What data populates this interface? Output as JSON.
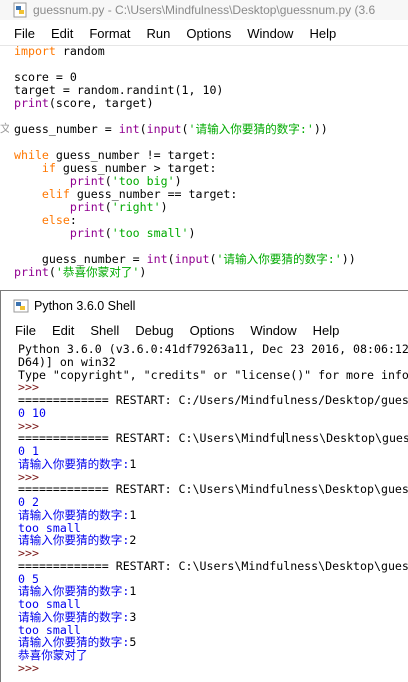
{
  "editor": {
    "title": "guessnum.py - C:\\Users\\Mindfulness\\Desktop\\guessnum.py (3.6",
    "menu": [
      "File",
      "Edit",
      "Format",
      "Run",
      "Options",
      "Window",
      "Help"
    ],
    "code": [
      [
        {
          "c": "kw",
          "t": "import"
        },
        {
          "c": "",
          "t": " random"
        }
      ],
      [],
      [
        {
          "c": "",
          "t": "score = 0"
        }
      ],
      [
        {
          "c": "",
          "t": "target = random.randint(1, 10)"
        }
      ],
      [
        {
          "c": "bi",
          "t": "print"
        },
        {
          "c": "",
          "t": "(score, target)"
        }
      ],
      [],
      [
        {
          "c": "",
          "t": "guess_number = "
        },
        {
          "c": "bi",
          "t": "int"
        },
        {
          "c": "",
          "t": "("
        },
        {
          "c": "bi",
          "t": "input"
        },
        {
          "c": "",
          "t": "("
        },
        {
          "c": "str",
          "t": "'请输入你要猜的数字:'"
        },
        {
          "c": "",
          "t": "))"
        }
      ],
      [],
      [
        {
          "c": "kw",
          "t": "while"
        },
        {
          "c": "",
          "t": " guess_number != target:"
        }
      ],
      [
        {
          "c": "",
          "t": "    "
        },
        {
          "c": "kw",
          "t": "if"
        },
        {
          "c": "",
          "t": " guess_number > target:"
        }
      ],
      [
        {
          "c": "",
          "t": "        "
        },
        {
          "c": "bi",
          "t": "print"
        },
        {
          "c": "",
          "t": "("
        },
        {
          "c": "str",
          "t": "'too big'"
        },
        {
          "c": "",
          "t": ")"
        }
      ],
      [
        {
          "c": "",
          "t": "    "
        },
        {
          "c": "kw",
          "t": "elif"
        },
        {
          "c": "",
          "t": " guess_number == target:"
        }
      ],
      [
        {
          "c": "",
          "t": "        "
        },
        {
          "c": "bi",
          "t": "print"
        },
        {
          "c": "",
          "t": "("
        },
        {
          "c": "str",
          "t": "'right'"
        },
        {
          "c": "",
          "t": ")"
        }
      ],
      [
        {
          "c": "",
          "t": "    "
        },
        {
          "c": "kw",
          "t": "else"
        },
        {
          "c": "",
          "t": ":"
        }
      ],
      [
        {
          "c": "",
          "t": "        "
        },
        {
          "c": "bi",
          "t": "print"
        },
        {
          "c": "",
          "t": "("
        },
        {
          "c": "str",
          "t": "'too small'"
        },
        {
          "c": "",
          "t": ")"
        }
      ],
      [],
      [
        {
          "c": "",
          "t": "    guess_number = "
        },
        {
          "c": "bi",
          "t": "int"
        },
        {
          "c": "",
          "t": "("
        },
        {
          "c": "bi",
          "t": "input"
        },
        {
          "c": "",
          "t": "("
        },
        {
          "c": "str",
          "t": "'请输入你要猜的数字:'"
        },
        {
          "c": "",
          "t": "))"
        }
      ],
      [
        {
          "c": "bi",
          "t": "print"
        },
        {
          "c": "",
          "t": "("
        },
        {
          "c": "str",
          "t": "'恭喜你蒙对了'"
        },
        {
          "c": "",
          "t": ")"
        }
      ]
    ]
  },
  "shell": {
    "title": "Python 3.6.0 Shell",
    "menu": [
      "File",
      "Edit",
      "Shell",
      "Debug",
      "Options",
      "Window",
      "Help"
    ],
    "lines": [
      [
        {
          "c": "",
          "t": "Python 3.6.0 (v3.6.0:41df79263a11, Dec 23 2016, 08:06:12"
        }
      ],
      [
        {
          "c": "",
          "t": "D64)] on win32"
        }
      ],
      [
        {
          "c": "",
          "t": "Type \"copyright\", \"credits\" or \"license()\" for more info"
        }
      ],
      [
        {
          "c": "prompt",
          "t": ">>> "
        }
      ],
      [
        {
          "c": "",
          "t": "============= RESTART: C:/Users/Mindfulness/Desktop/gues"
        }
      ],
      [
        {
          "c": "out",
          "t": "0 10"
        }
      ],
      [
        {
          "c": "prompt",
          "t": ">>> "
        }
      ],
      [
        {
          "c": "",
          "t": "============= RESTART: C:\\Users\\Mindfu"
        },
        {
          "c": "cursor",
          "t": ""
        },
        {
          "c": "",
          "t": "lness\\Desktop\\gues"
        }
      ],
      [
        {
          "c": "out",
          "t": "0 1"
        }
      ],
      [
        {
          "c": "out",
          "t": "请输入你要猜的数字:"
        },
        {
          "c": "stdin",
          "t": "1"
        }
      ],
      [
        {
          "c": "prompt",
          "t": ">>> "
        }
      ],
      [
        {
          "c": "",
          "t": "============= RESTART: C:\\Users\\Mindfulness\\Desktop\\gues"
        }
      ],
      [
        {
          "c": "out",
          "t": "0 2"
        }
      ],
      [
        {
          "c": "out",
          "t": "请输入你要猜的数字:"
        },
        {
          "c": "stdin",
          "t": "1"
        }
      ],
      [
        {
          "c": "out",
          "t": "too small"
        }
      ],
      [
        {
          "c": "out",
          "t": "请输入你要猜的数字:"
        },
        {
          "c": "stdin",
          "t": "2"
        }
      ],
      [
        {
          "c": "prompt",
          "t": ">>> "
        }
      ],
      [
        {
          "c": "",
          "t": "============= RESTART: C:\\Users\\Mindfulness\\Desktop\\gues"
        }
      ],
      [
        {
          "c": "out",
          "t": "0 5"
        }
      ],
      [
        {
          "c": "out",
          "t": "请输入你要猜的数字:"
        },
        {
          "c": "stdin",
          "t": "1"
        }
      ],
      [
        {
          "c": "out",
          "t": "too small"
        }
      ],
      [
        {
          "c": "out",
          "t": "请输入你要猜的数字:"
        },
        {
          "c": "stdin",
          "t": "3"
        }
      ],
      [
        {
          "c": "out",
          "t": "too small"
        }
      ],
      [
        {
          "c": "out",
          "t": "请输入你要猜的数字:"
        },
        {
          "c": "stdin",
          "t": "5"
        }
      ],
      [
        {
          "c": "out",
          "t": "恭喜你蒙对了"
        }
      ],
      [
        {
          "c": "prompt",
          "t": ">>> "
        }
      ]
    ]
  },
  "icons": {
    "editor": "python-file-icon",
    "shell": "python-shell-icon"
  },
  "colors": {
    "keyword": "#ff7700",
    "builtin": "#900090",
    "string": "#00aa00",
    "stdout": "#0000ee",
    "prompt": "#7a1a1a"
  }
}
